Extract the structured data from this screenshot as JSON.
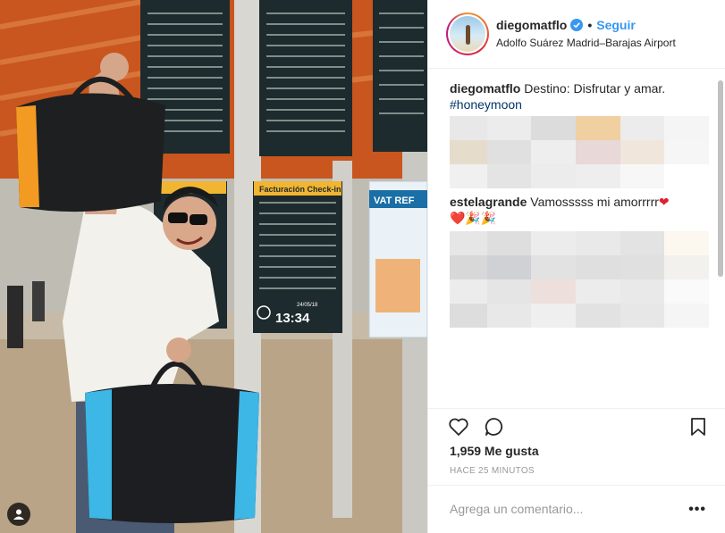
{
  "post": {
    "photo_alt": "Man with sunglasses holding two black bags in front of airport departure boards",
    "board_sign_1": "Facturación Check-in",
    "board_sign_2": "Facturación Check-in",
    "board_clock": "13:34",
    "board_date": "24/05/18",
    "vat_sign": "VAT REF"
  },
  "header": {
    "username": "diegomatflo",
    "separator": "•",
    "follow_label": "Seguir",
    "location": "Adolfo Suárez Madrid–Barajas Airport"
  },
  "caption": {
    "username": "diegomatflo",
    "text": "Destino: Disfrutar y amar.",
    "hashtag": "#honeymoon"
  },
  "comment": {
    "username": "estelagrande",
    "text": "Vamosssss mi amorrrrr",
    "emoji_line": "❤️🎉🎉"
  },
  "blurred_colors_1": [
    "#e8e8e8",
    "#ececec",
    "#dcdcdc",
    "#f0cfa0",
    "#ececec",
    "#f5f5f5",
    "#e6dccc",
    "#e0e0e0",
    "#eeeeee",
    "#e8d8d8",
    "#f1e6dc",
    "#f6f6f6",
    "#f0f0f0",
    "#e4e4e4",
    "#ececec",
    "#eeeeee",
    "#f7f7f7",
    "#ffffff"
  ],
  "blurred_colors_2": [
    "#e6e6e6",
    "#dedede",
    "#ececec",
    "#e9e9e9",
    "#e3e3e3",
    "#fdf8ef",
    "#d8d8d8",
    "#cfd1d4",
    "#e2e2e2",
    "#dfdfdf",
    "#e0e0e0",
    "#f3f1ee",
    "#ececec",
    "#e5e5e5",
    "#ede0dc",
    "#ececec",
    "#e9e9e9",
    "#fafafa",
    "#dddddd",
    "#e8e8e8",
    "#efefef",
    "#e2e2e2",
    "#e7e7e7",
    "#f5f5f5"
  ],
  "stats": {
    "likes": "1,959 Me gusta",
    "timestamp": "HACE 25 MINUTOS"
  },
  "add_comment": {
    "placeholder": "Agrega un comentario...",
    "more_label": "•••"
  },
  "colors": {
    "accent": "#3897f0",
    "verified": "#3897f0",
    "text": "#262626",
    "muted": "#999999"
  },
  "icons": {
    "verified": "verified-badge-icon",
    "like": "heart-outline-icon",
    "comment": "speech-bubble-icon",
    "save": "bookmark-icon",
    "tag": "person-tag-icon"
  }
}
